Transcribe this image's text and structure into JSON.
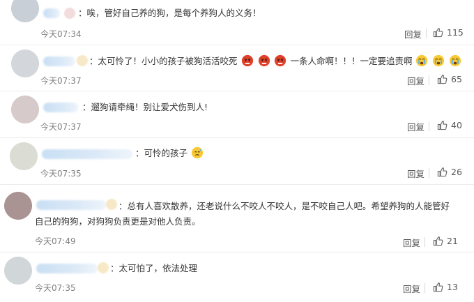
{
  "comments": [
    {
      "text": "唉，管好自己养的狗，是每个养狗人的义务！",
      "time": "今天07:34",
      "reply": "回复",
      "likes": "115",
      "avatar_color": "#b7bfc9"
    },
    {
      "text_a": "太可怜了！小小的孩子被狗活活咬死",
      "text_b": "一条人命啊！！！一定要追责啊",
      "time": "今天07:37",
      "reply": "回复",
      "likes": "65",
      "avatar_color": "#c4c8cf"
    },
    {
      "text": "遛狗请牵绳！别让爱犬伤到人!",
      "time": "今天07:37",
      "reply": "回复",
      "likes": "40",
      "avatar_color": "#c9b8b8"
    },
    {
      "text": "可怜的孩子",
      "time": "今天07:35",
      "reply": "回复",
      "likes": "26",
      "avatar_color": "#cfd0c4"
    },
    {
      "text_line1": "总有人喜欢散养，还老说什么不咬人不咬人，是不咬自己人吧。希望养狗的人能管好",
      "text_line2": "自己的狗狗，对狗狗负责更是对他人负责。",
      "time": "今天07:49",
      "reply": "回复",
      "likes": "21",
      "avatar_color": "#8e6f6f"
    },
    {
      "text": "太可怕了，依法处理",
      "time": "今天07:35",
      "reply": "回复",
      "likes": "13",
      "avatar_color": "#c2c8cc"
    }
  ],
  "icons": {
    "like": "thumbs-up-icon",
    "angry_emoji": "angry-face-icon",
    "crying_emoji": "crying-face-icon",
    "sad_emoji": "sad-sweat-face-icon"
  },
  "colors": {
    "text": "#333333",
    "meta": "#808080",
    "name_blur": "#c9dff4"
  }
}
